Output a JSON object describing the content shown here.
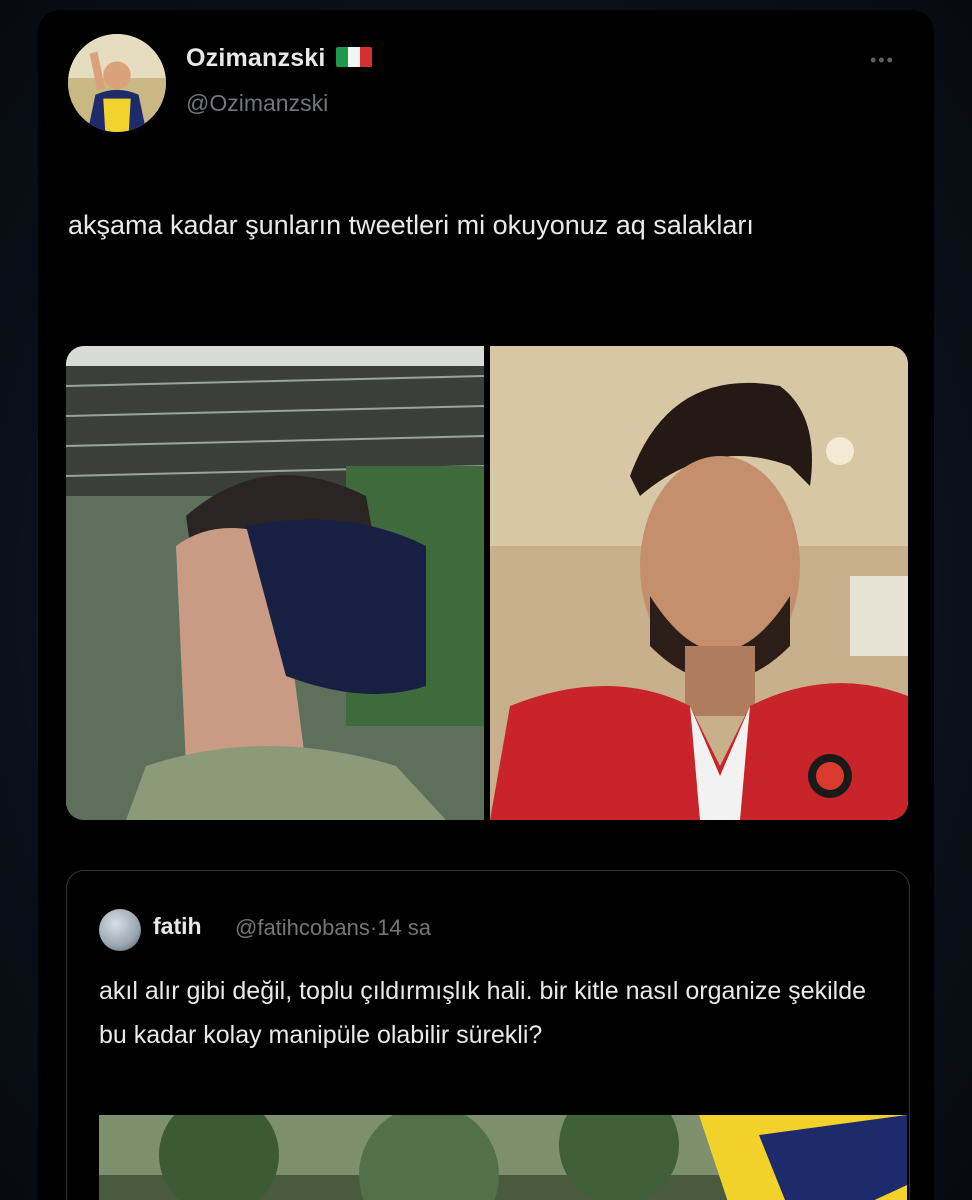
{
  "tweet": {
    "display_name": "Ozimanzski",
    "flag_icon": "italy-flag-icon",
    "handle": "@Ozimanzski",
    "more_icon": "more-options-icon",
    "text": "akşama kadar şunların tweetleri mi okuyonuz aq salakları"
  },
  "quote": {
    "name": "fatih",
    "handle": "@fatihcobans",
    "time": "14 sa",
    "text": "akıl alır gibi değil, toplu çıldırmışlık hali. bir kitle nasıl organize şekilde bu kadar kolay manipüle olabilir sürekli?"
  },
  "colors": {
    "background": "#000000",
    "text_primary": "#e7e9ea",
    "text_secondary": "#71767b",
    "border": "#2f3336"
  }
}
